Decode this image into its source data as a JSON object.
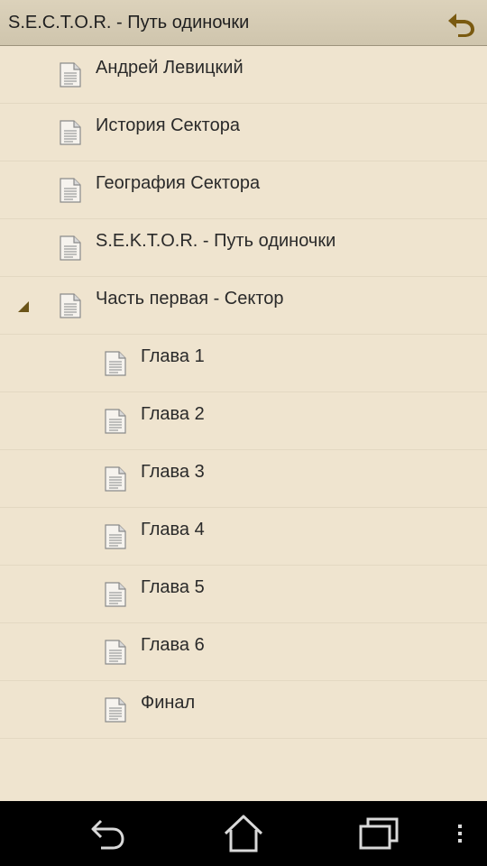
{
  "header": {
    "title": "S.E.C.T.O.R. - Путь одиночки",
    "back_icon": "undo-arrow-icon",
    "accent_color": "#7a5a10"
  },
  "toc": {
    "items": [
      {
        "label": "Андрей Левицкий",
        "level": 0
      },
      {
        "label": "История Сектора",
        "level": 0
      },
      {
        "label": "География Сектора",
        "level": 0
      },
      {
        "label": "S.E.K.T.O.R. - Путь одиночки",
        "level": 0
      },
      {
        "label": "Часть первая - Сектор",
        "level": 0,
        "expanded": true
      },
      {
        "label": "Глава 1",
        "level": 1
      },
      {
        "label": "Глава 2",
        "level": 1
      },
      {
        "label": "Глава 3",
        "level": 1
      },
      {
        "label": "Глава 4",
        "level": 1
      },
      {
        "label": "Глава 5",
        "level": 1
      },
      {
        "label": "Глава 6",
        "level": 1
      },
      {
        "label": "Финал",
        "level": 1
      }
    ]
  },
  "navbar": {
    "buttons": [
      "back-icon",
      "home-icon",
      "recent-apps-icon",
      "overflow-menu-icon"
    ]
  },
  "colors": {
    "background": "#efe4cf",
    "header": "#d5cbb3",
    "text": "#2a2a2a",
    "navbar": "#000000"
  }
}
